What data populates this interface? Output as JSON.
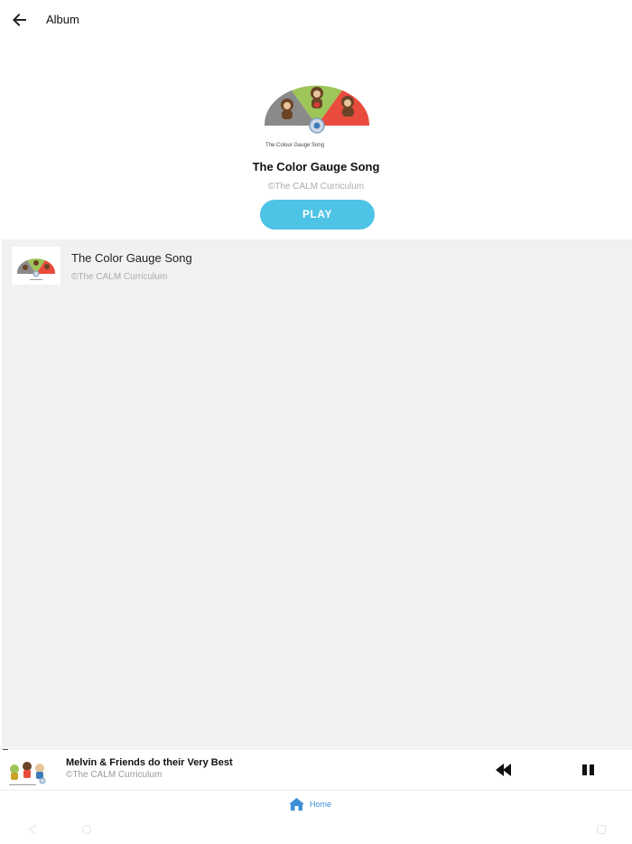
{
  "header": {
    "title": "Album",
    "back_icon": "arrow-left-icon"
  },
  "album": {
    "art_caption": "The Colour Gauge Song",
    "title": "The Color Gauge Song",
    "copyright": "©The CALM Curriculum",
    "play_label": "PLAY"
  },
  "tracks": [
    {
      "title": "The Color Gauge Song",
      "copyright": "©The CALM Curriculum"
    }
  ],
  "now_playing": {
    "title": "Melvin & Friends do their Very Best",
    "copyright": "©The CALM Curriculum",
    "rewind_icon": "rewind-icon",
    "pause_icon": "pause-icon"
  },
  "nav": {
    "home_label": "Home",
    "home_icon": "home-icon"
  },
  "colors": {
    "accent": "#4dc3e6",
    "nav_accent": "#3d8fd8",
    "gauge_grey": "#8a8a8a",
    "gauge_green": "#9dc55a",
    "gauge_red": "#e94b3c"
  }
}
